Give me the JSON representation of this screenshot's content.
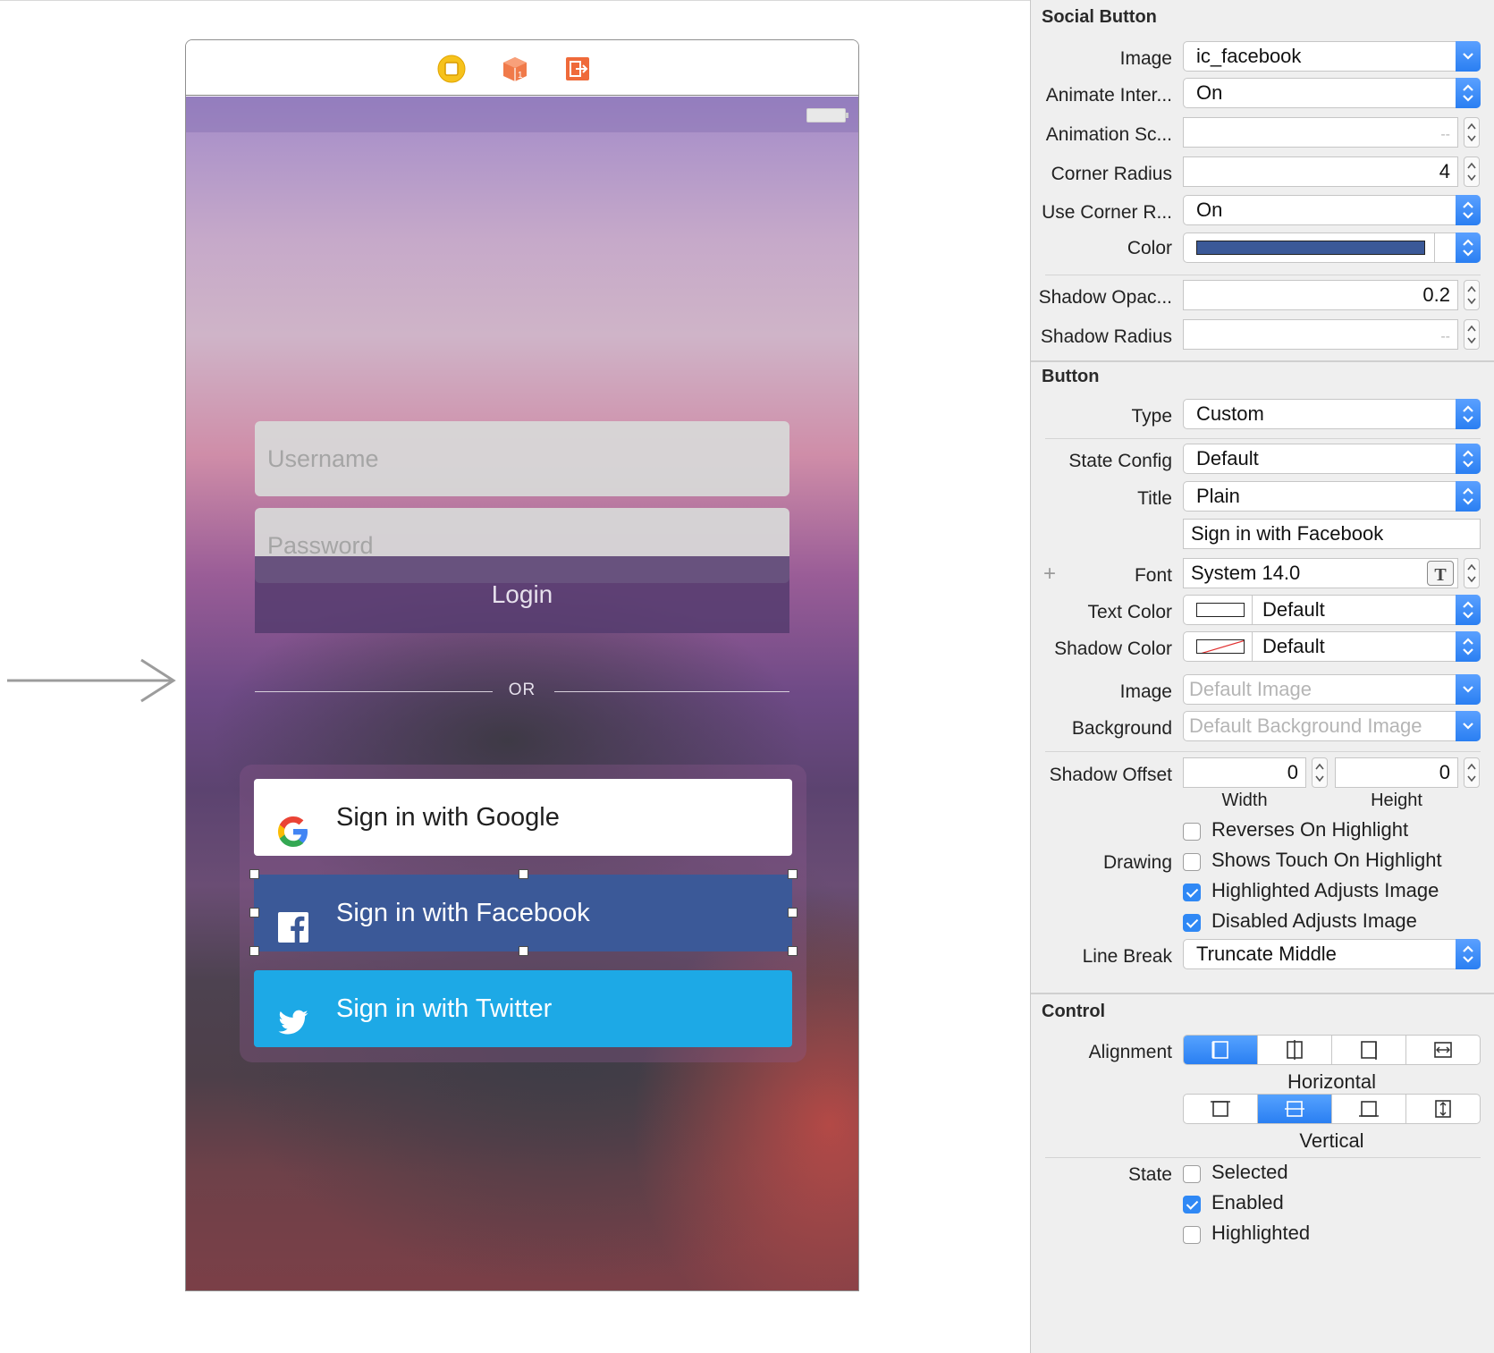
{
  "canvas": {
    "fields": {
      "username_placeholder": "Username",
      "password_placeholder": "Password"
    },
    "login_label": "Login",
    "or_label": "OR",
    "social_buttons": {
      "google": "Sign in with Google",
      "facebook": "Sign in with Facebook",
      "twitter": "Sign in with Twitter"
    },
    "colors": {
      "facebook": "#3b5998",
      "twitter": "#1da9e6",
      "google_bg": "#ffffff"
    },
    "scene_icons": [
      "view-controller-icon",
      "first-responder-icon",
      "exit-icon"
    ]
  },
  "inspector": {
    "social_button": {
      "title": "Social Button",
      "image_label": "Image",
      "image_value": "ic_facebook",
      "animate_label": "Animate Inter...",
      "animate_value": "On",
      "anim_scale_label": "Animation Sc...",
      "anim_scale_value": "--",
      "corner_radius_label": "Corner Radius",
      "corner_radius_value": "4",
      "use_corner_label": "Use Corner R...",
      "use_corner_value": "On",
      "color_label": "Color",
      "color_value": "#3b5998",
      "shadow_opacity_label": "Shadow Opac...",
      "shadow_opacity_value": "0.2",
      "shadow_radius_label": "Shadow Radius",
      "shadow_radius_value": "--"
    },
    "button": {
      "title": "Button",
      "type_label": "Type",
      "type_value": "Custom",
      "state_config_label": "State Config",
      "state_config_value": "Default",
      "title_label": "Title",
      "title_value": "Plain",
      "title_text": "Sign in with Facebook",
      "font_label": "Font",
      "font_value": "System 14.0",
      "text_color_label": "Text Color",
      "text_color_value": "Default",
      "shadow_color_label": "Shadow Color",
      "shadow_color_value": "Default",
      "image_label": "Image",
      "image_placeholder": "Default Image",
      "background_label": "Background",
      "background_placeholder": "Default Background Image",
      "shadow_offset_label": "Shadow Offset",
      "shadow_offset_width": "0",
      "shadow_offset_height": "0",
      "width_caption": "Width",
      "height_caption": "Height",
      "drawing_label": "Drawing",
      "drawing_options": [
        {
          "label": "Reverses On Highlight",
          "checked": false
        },
        {
          "label": "Shows Touch On Highlight",
          "checked": false
        },
        {
          "label": "Highlighted Adjusts Image",
          "checked": true
        },
        {
          "label": "Disabled Adjusts Image",
          "checked": true
        }
      ],
      "line_break_label": "Line Break",
      "line_break_value": "Truncate Middle"
    },
    "control": {
      "title": "Control",
      "alignment_label": "Alignment",
      "horizontal_caption": "Horizontal",
      "vertical_caption": "Vertical",
      "state_label": "State",
      "state_options": [
        {
          "label": "Selected",
          "checked": false
        },
        {
          "label": "Enabled",
          "checked": true
        },
        {
          "label": "Highlighted",
          "checked": false
        }
      ]
    }
  }
}
